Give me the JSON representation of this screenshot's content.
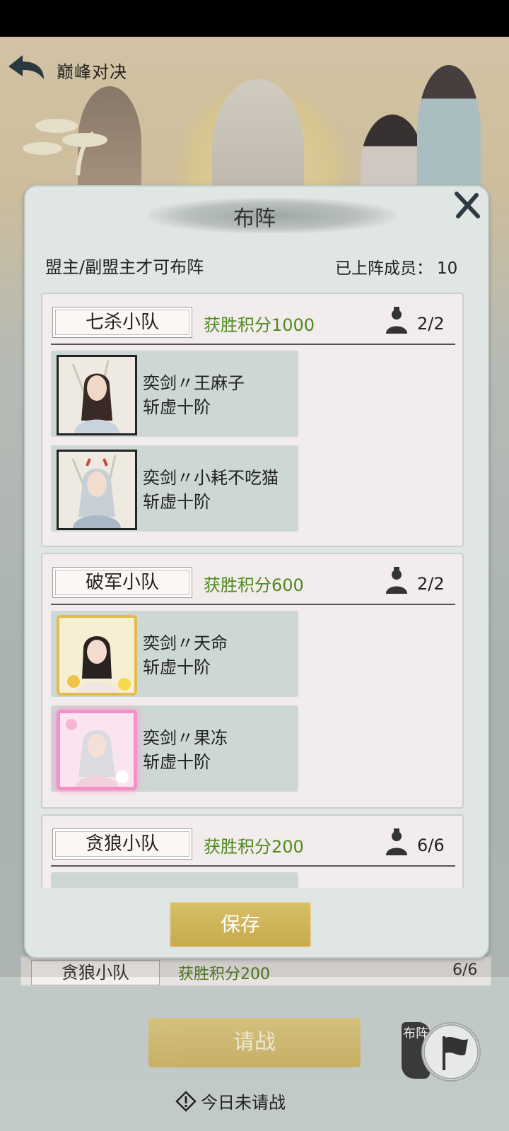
{
  "header": {
    "title": "巅峰对决",
    "back_icon": "back-arrow-icon"
  },
  "modal": {
    "title": "布阵",
    "close_icon": "close-x-icon",
    "notice": "盟主/副盟主才可布阵",
    "member_count_label": "已上阵成员：",
    "member_count_value": "10",
    "save_label": "保存"
  },
  "teams": [
    {
      "name": "七杀小队",
      "score": "获胜积分1000",
      "count": "2/2",
      "members": [
        {
          "name": "奕剑〃王麻子",
          "rank": "斩虚十阶",
          "frame": "plain"
        },
        {
          "name": "奕剑〃小耗不吃猫",
          "rank": "斩虚十阶",
          "frame": "plain"
        }
      ]
    },
    {
      "name": "破军小队",
      "score": "获胜积分600",
      "count": "2/2",
      "members": [
        {
          "name": "奕剑〃天命",
          "rank": "斩虚十阶",
          "frame": "gold"
        },
        {
          "name": "奕剑〃果冻",
          "rank": "斩虚十阶",
          "frame": "pink"
        }
      ]
    },
    {
      "name": "贪狼小队",
      "score": "获胜积分200",
      "count": "6/6",
      "members": []
    }
  ],
  "background": {
    "team_row": {
      "name": "贪狼小队",
      "score": "获胜积分200",
      "count": "6/6"
    },
    "request_label": "请战",
    "today_status": "今日未请战",
    "today_icon": "warning-diamond-icon",
    "buzhen_badge": "布阵",
    "flag_icon": "flag-icon"
  },
  "colors": {
    "score_green": "#4e8a1e",
    "gold_button": "#c9aa50",
    "panel_bg": "#dfe6e3",
    "card_bg": "#f3ecec"
  }
}
